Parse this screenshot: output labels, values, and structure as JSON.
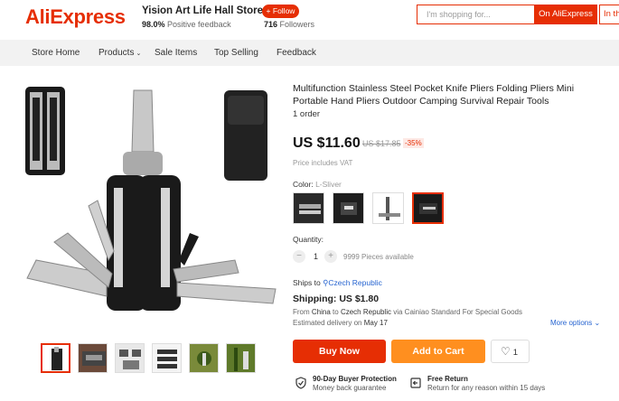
{
  "header": {
    "logo": "AliExpress",
    "store_name": "Yision Art Life Hall Store",
    "feedback_value": "98.0%",
    "feedback_text": "Positive feedback",
    "follow_label": "+ Follow",
    "followers_count": "716",
    "followers_text": "Followers",
    "search_placeholder": "I'm shopping for...",
    "search_button": "On AliExpress",
    "search_button2": "In th"
  },
  "nav": {
    "items": [
      "Store Home",
      "Products",
      "Sale Items",
      "Top Selling",
      "Feedback"
    ]
  },
  "product": {
    "title": "Multifunction Stainless Steel Pocket Knife Pliers Folding Pliers Mini Portable Hand Pliers Outdoor Camping Survival Repair Tools",
    "orders": "1 order",
    "price": "US $11.60",
    "old_price": "US $17.85",
    "discount": "-35%",
    "vat_note": "Price includes VAT",
    "color_label": "Color:",
    "color_value": "L-Sliver",
    "quantity_label": "Quantity:",
    "quantity_value": "1",
    "qty_minus": "−",
    "qty_plus": "+",
    "available": "9999 Pieces available",
    "ships_to_label": "Ships to",
    "ships_to_value": "Czech Republic",
    "shipping": "Shipping: US $1.80",
    "ship_from_prefix": "From",
    "ship_from_origin": "China",
    "ship_from_to": "to",
    "ship_from_dest": "Czech Republic",
    "ship_from_suffix": "via Cainiao Standard For Special Goods",
    "delivery_prefix": "Estimated delivery on",
    "delivery_date": "May 17",
    "more_options": "More options",
    "buy_now": "Buy Now",
    "add_to_cart": "Add to Cart",
    "wishlist_count": "1"
  },
  "guarantees": [
    {
      "title": "90-Day Buyer Protection",
      "sub": "Money back guarantee",
      "icon": "shield-check-icon"
    },
    {
      "title": "Free Return",
      "sub": "Return for any reason within 15 days",
      "icon": "return-icon"
    }
  ],
  "colors": {
    "brand": "#e62e04",
    "cart": "#ff8f1f",
    "link": "#2563d0"
  }
}
